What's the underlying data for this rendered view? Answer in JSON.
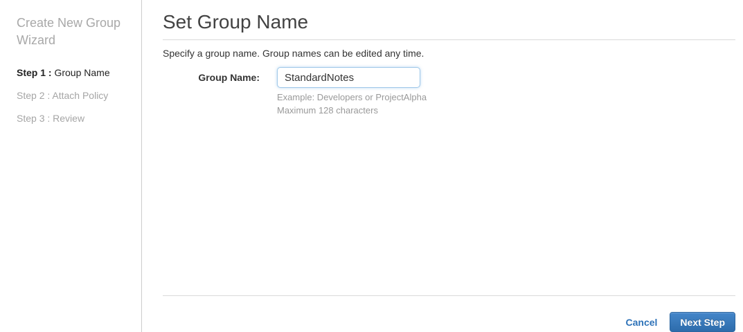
{
  "sidebar": {
    "title": "Create New Group Wizard",
    "steps": [
      {
        "prefix": "Step 1 : ",
        "label": "Group Name",
        "active": true
      },
      {
        "prefix": "Step 2 : ",
        "label": "Attach Policy",
        "active": false
      },
      {
        "prefix": "Step 3 : ",
        "label": "Review",
        "active": false
      }
    ]
  },
  "main": {
    "title": "Set Group Name",
    "description": "Specify a group name. Group names can be edited any time.",
    "form": {
      "group_name_label": "Group Name:",
      "group_name_value": "StandardNotes",
      "hint_example": "Example: Developers or ProjectAlpha",
      "hint_max": "Maximum 128 characters"
    },
    "footer": {
      "cancel_label": "Cancel",
      "next_label": "Next Step"
    }
  },
  "colors": {
    "accent_link_blue": "#2d72b8",
    "button_gradient_top": "#4486ca",
    "button_gradient_bottom": "#2d6cab",
    "button_border": "#2a65a0",
    "input_focus_border": "#9fc8e9",
    "inactive_step_gray": "#a5a5a5",
    "divider_gray": "#d9d9d9"
  }
}
